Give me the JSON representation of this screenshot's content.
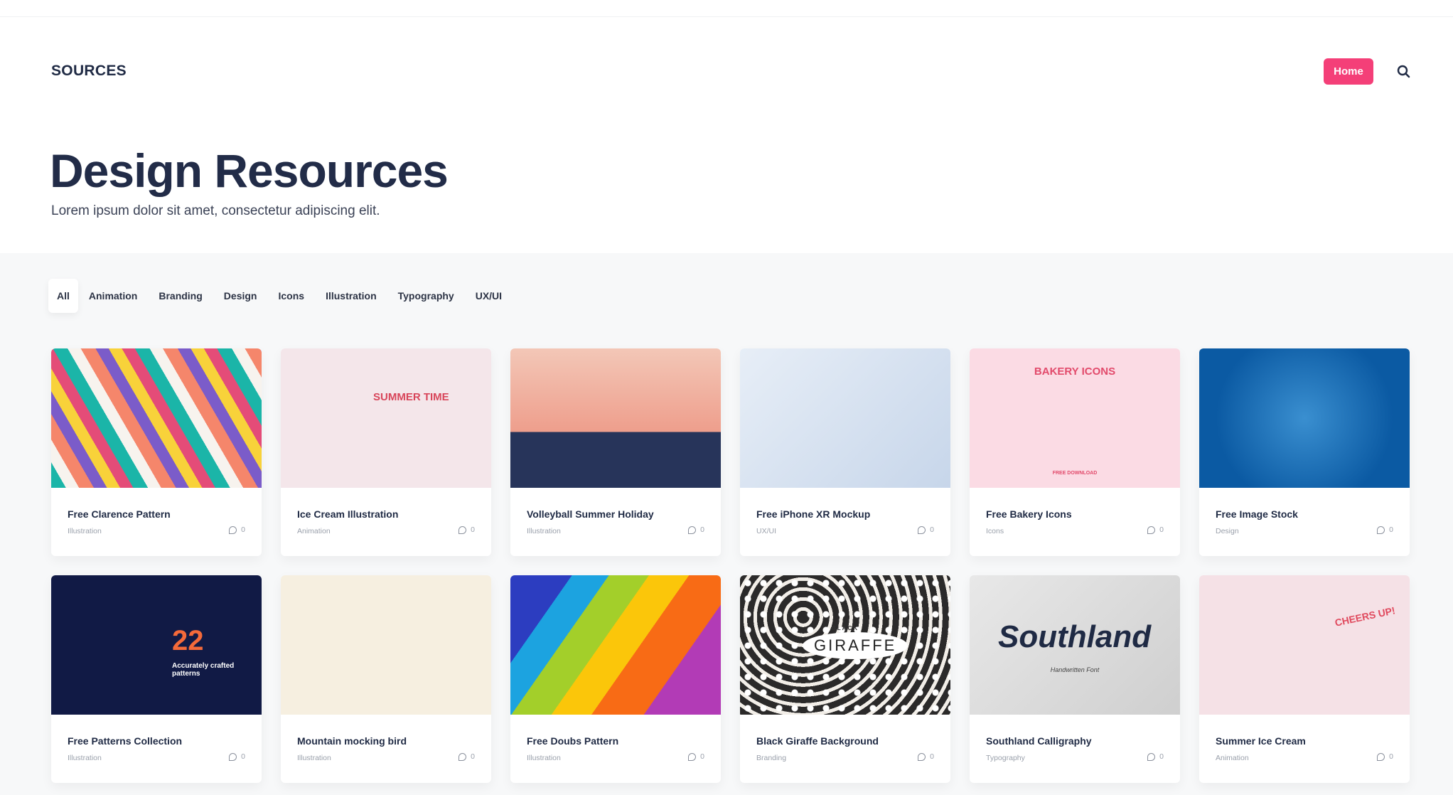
{
  "header": {
    "logo": "SOURCES",
    "home_label": "Home",
    "search_icon": "search-icon",
    "accent": "#f43f78"
  },
  "hero": {
    "title": "Design Resources",
    "subtitle": "Lorem ipsum dolor sit amet, consectetur adipiscing elit."
  },
  "filters": {
    "active": "All",
    "items": [
      "All",
      "Animation",
      "Branding",
      "Design",
      "Icons",
      "Illustration",
      "Typography",
      "UX/UI"
    ]
  },
  "cards": [
    {
      "title": "Free Clarence Pattern",
      "category": "Illustration",
      "comments": "0"
    },
    {
      "title": "Ice Cream Illustration",
      "category": "Animation",
      "comments": "0",
      "art_text": "SUMMER TIME"
    },
    {
      "title": "Volleyball Summer Holiday",
      "category": "Illustration",
      "comments": "0"
    },
    {
      "title": "Free iPhone XR Mockup",
      "category": "UX/UI",
      "comments": "0"
    },
    {
      "title": "Free Bakery Icons",
      "category": "Icons",
      "comments": "0",
      "art_text": "BAKERY ICONS",
      "art_sub": "FREE DOWNLOAD"
    },
    {
      "title": "Free Image Stock",
      "category": "Design",
      "comments": "0"
    },
    {
      "title": "Free Patterns Collection",
      "category": "Illustration",
      "comments": "0",
      "art_text": "22",
      "art_sub": "Accurately crafted patterns"
    },
    {
      "title": "Mountain mocking bird",
      "category": "Illustration",
      "comments": "0"
    },
    {
      "title": "Free Doubs Pattern",
      "category": "Illustration",
      "comments": "0"
    },
    {
      "title": "Black Giraffe Background",
      "category": "Branding",
      "comments": "0",
      "art_text": "GIRAFFE",
      "art_sub": "BLACK"
    },
    {
      "title": "Southland Calligraphy",
      "category": "Typography",
      "comments": "0",
      "art_text": "Southland",
      "art_sub": "Handwritten Font"
    },
    {
      "title": "Summer Ice Cream",
      "category": "Animation",
      "comments": "0",
      "art_text": "CHEERS UP!"
    }
  ]
}
